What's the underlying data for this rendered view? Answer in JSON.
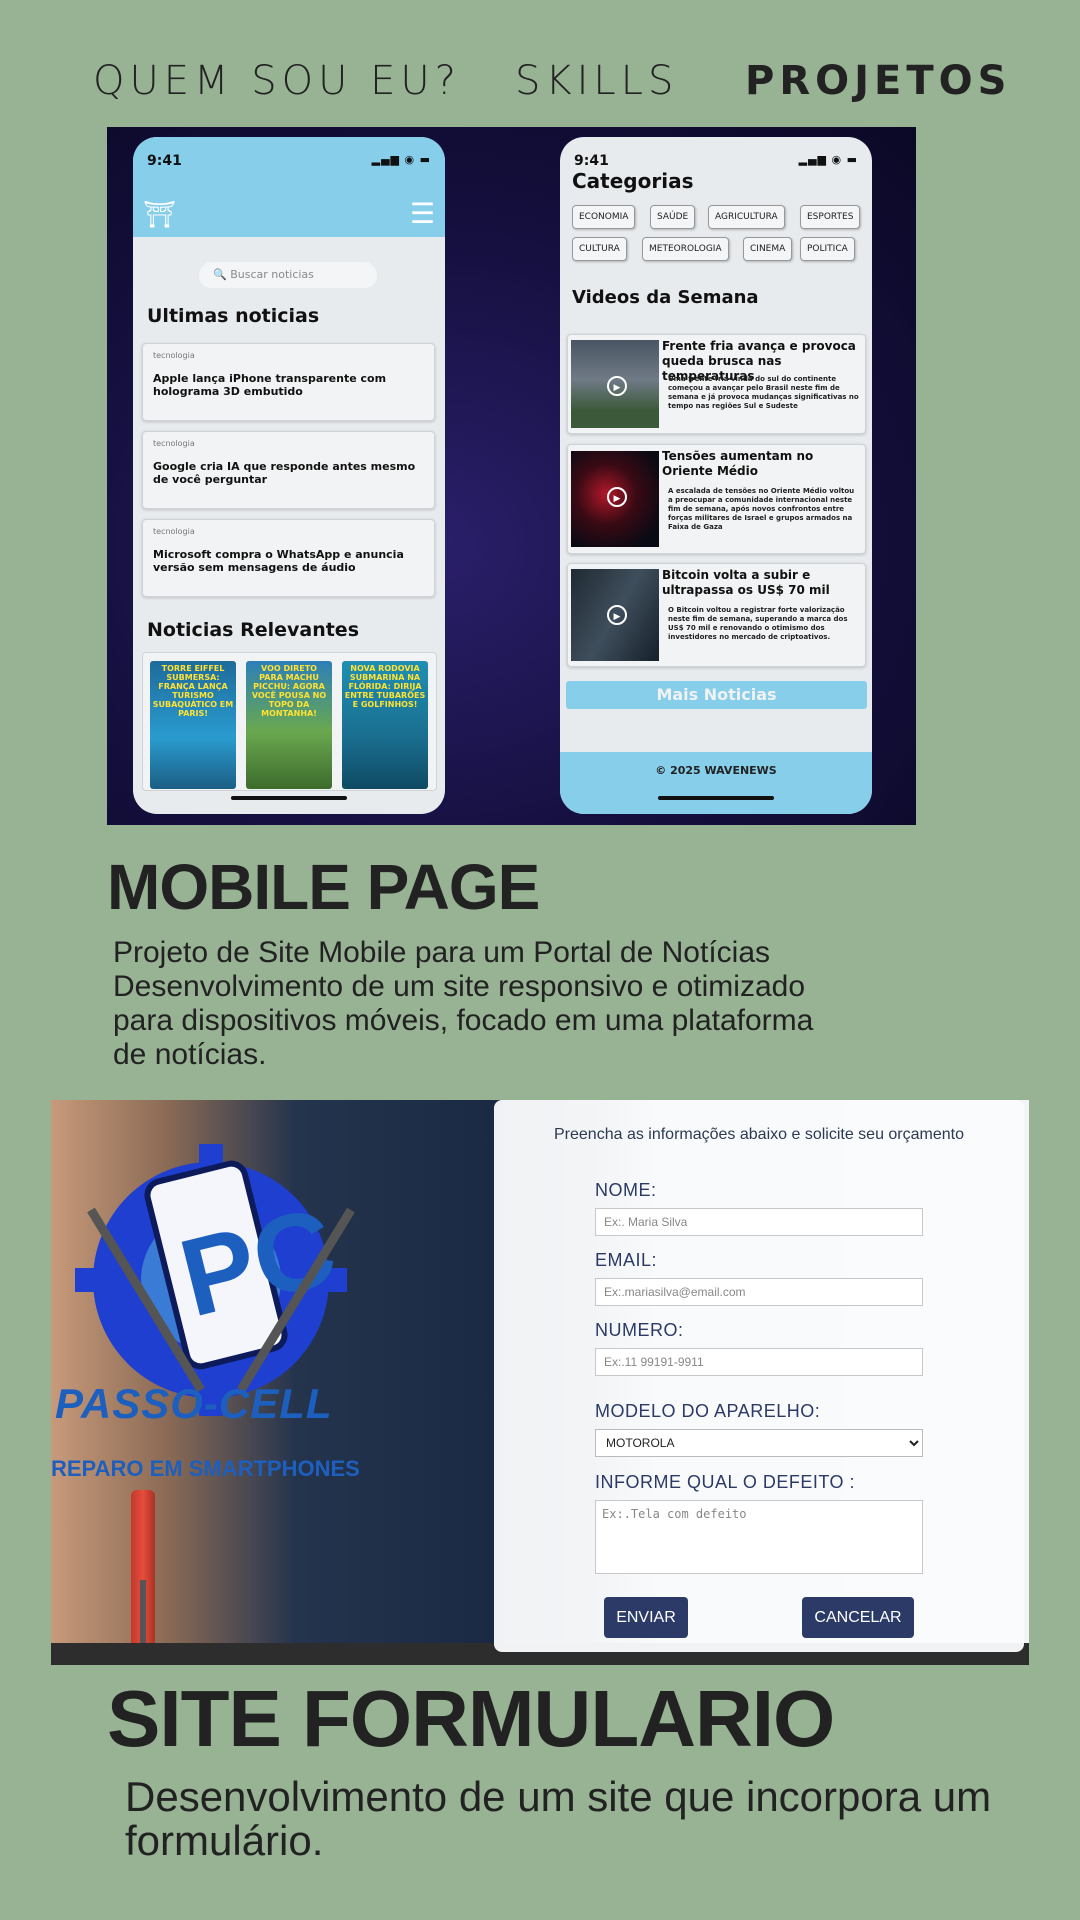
{
  "colors": {
    "background": "#97b394",
    "text": "#222222",
    "phone_accent": "#87ceeb",
    "form_button": "#2b3a67",
    "brand_blue": "#1d5fbf"
  },
  "nav": {
    "items": [
      {
        "label": "QUEM SOU EU?"
      },
      {
        "label": "SKILLS"
      },
      {
        "label": "PROJETOS",
        "active": true
      }
    ]
  },
  "mobile_mockup": {
    "phone1": {
      "time": "9:41",
      "logo_icon": "temple-icon",
      "menu_icon": "hamburger-icon",
      "search_placeholder": "Buscar noticias",
      "latest_title": "Ultimas noticias",
      "news": [
        {
          "category": "tecnologia",
          "title": "Apple lança iPhone transparente com holograma 3D embutido"
        },
        {
          "category": "tecnologia",
          "title": "Google cria IA que responde antes mesmo de você perguntar"
        },
        {
          "category": "tecnologia",
          "title": "Microsoft compra o WhatsApp e anuncia versão sem mensagens de áudio"
        }
      ],
      "relevant_title": "Noticias Relevantes",
      "relevant": [
        {
          "caption": "TORRE EIFFEL SUBMERSA: FRANÇA LANÇA TURISMO SUBAQUÁTICO EM PARIS!"
        },
        {
          "caption": "VOO DIRETO PARA MACHU PICCHU: AGORA VOCÊ POUSA NO TOPO DA MONTANHA!"
        },
        {
          "caption": "NOVA RODOVIA SUBMARINA NA FLÓRIDA: DIRIJA ENTRE TUBARÕES E GOLFINHOS!"
        }
      ]
    },
    "phone2": {
      "time": "9:41",
      "categories_title": "Categorias",
      "categories": [
        "ECONOMIA",
        "SAÚDE",
        "AGRICULTURA",
        "ESPORTES",
        "CULTURA",
        "METEOROLOGIA",
        "CINEMA",
        "POLITICA"
      ],
      "videos_title": "Videos da Semana",
      "videos": [
        {
          "title": "Frente fria avança e provoca queda brusca nas temperaturas",
          "desc": "Uma frente fria vinda do sul do continente começou a avançar pelo Brasil neste fim de semana e já provoca mudanças significativas no tempo nas regiões Sul e Sudeste"
        },
        {
          "title": "Tensões aumentam no Oriente Médio",
          "desc": "A escalada de tensões no Oriente Médio voltou a preocupar a comunidade internacional neste fim de semana, após novos confrontos entre forças militares de Israel e grupos armados na Faixa de Gaza"
        },
        {
          "title": "Bitcoin volta a subir e ultrapassa os US$ 70 mil",
          "desc": "O Bitcoin voltou a registrar forte valorização neste fim de semana, superando a marca dos US$ 70 mil e renovando o otimismo dos investidores no mercado de criptoativos."
        }
      ],
      "more_button": "Mais Noticias",
      "footer": "© 2025 WAVENEWS"
    }
  },
  "project1": {
    "title": "MOBILE PAGE",
    "description": "Projeto de Site Mobile para um Portal de Notícias Desenvolvimento de um site responsivo e otimizado para dispositivos móveis, focado em uma plataforma de notícias."
  },
  "form_mockup": {
    "brand": "PASSO-CELL",
    "brand_sub": "REPARO EM SMARTPHONES",
    "intro": "Preencha as informações abaixo e solicite seu orçamento",
    "name_label": "NOME:",
    "name_placeholder": "Ex:. Maria Silva",
    "email_label": "EMAIL:",
    "email_placeholder": "Ex:.mariasilva@email.com",
    "number_label": "NUMERO:",
    "number_placeholder": "Ex:.11 99191-9911",
    "model_label": "MODELO DO APARELHO:",
    "model_value": "MOTOROLA",
    "defect_label": "INFORME QUAL O DEFEITO :",
    "defect_placeholder": "Ex:.Tela com defeito",
    "send_button": "ENVIAR",
    "cancel_button": "CANCELAR"
  },
  "project2": {
    "title": "SITE FORMULARIO",
    "description": "Desenvolvimento de um site que incorpora um formulário."
  }
}
